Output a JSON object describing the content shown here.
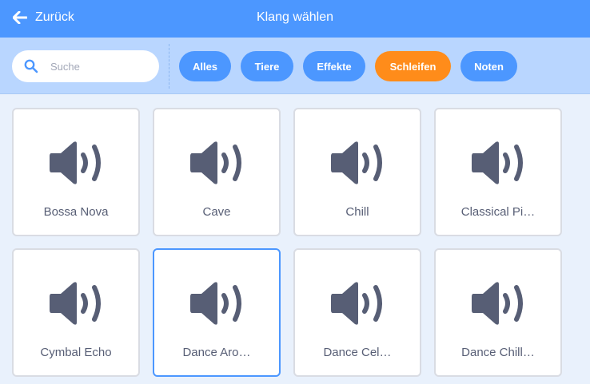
{
  "header": {
    "back_label": "Zurück",
    "title": "Klang wählen",
    "color": "#4c97ff"
  },
  "search": {
    "placeholder": "Suche",
    "value": ""
  },
  "filters": [
    {
      "label": "Alles",
      "active": false
    },
    {
      "label": "Tiere",
      "active": false
    },
    {
      "label": "Effekte",
      "active": false
    },
    {
      "label": "Schleifen",
      "active": true
    },
    {
      "label": "Noten",
      "active": false
    }
  ],
  "colors": {
    "accent": "#4c97ff",
    "active_tag": "#ff8c1a",
    "icon": "#575e75"
  },
  "sounds": [
    {
      "name": "Bossa Nova",
      "icon": "speaker-icon",
      "selected": false
    },
    {
      "name": "Cave",
      "icon": "speaker-icon",
      "selected": false
    },
    {
      "name": "Chill",
      "icon": "speaker-icon",
      "selected": false
    },
    {
      "name": "Classical Pi…",
      "icon": "speaker-icon",
      "selected": false
    },
    {
      "name": "Cymbal Echo",
      "icon": "speaker-icon",
      "selected": false
    },
    {
      "name": "Dance Aro…",
      "icon": "speaker-icon",
      "selected": true
    },
    {
      "name": "Dance Cel…",
      "icon": "speaker-icon",
      "selected": false
    },
    {
      "name": "Dance Chill…",
      "icon": "speaker-icon",
      "selected": false
    }
  ]
}
